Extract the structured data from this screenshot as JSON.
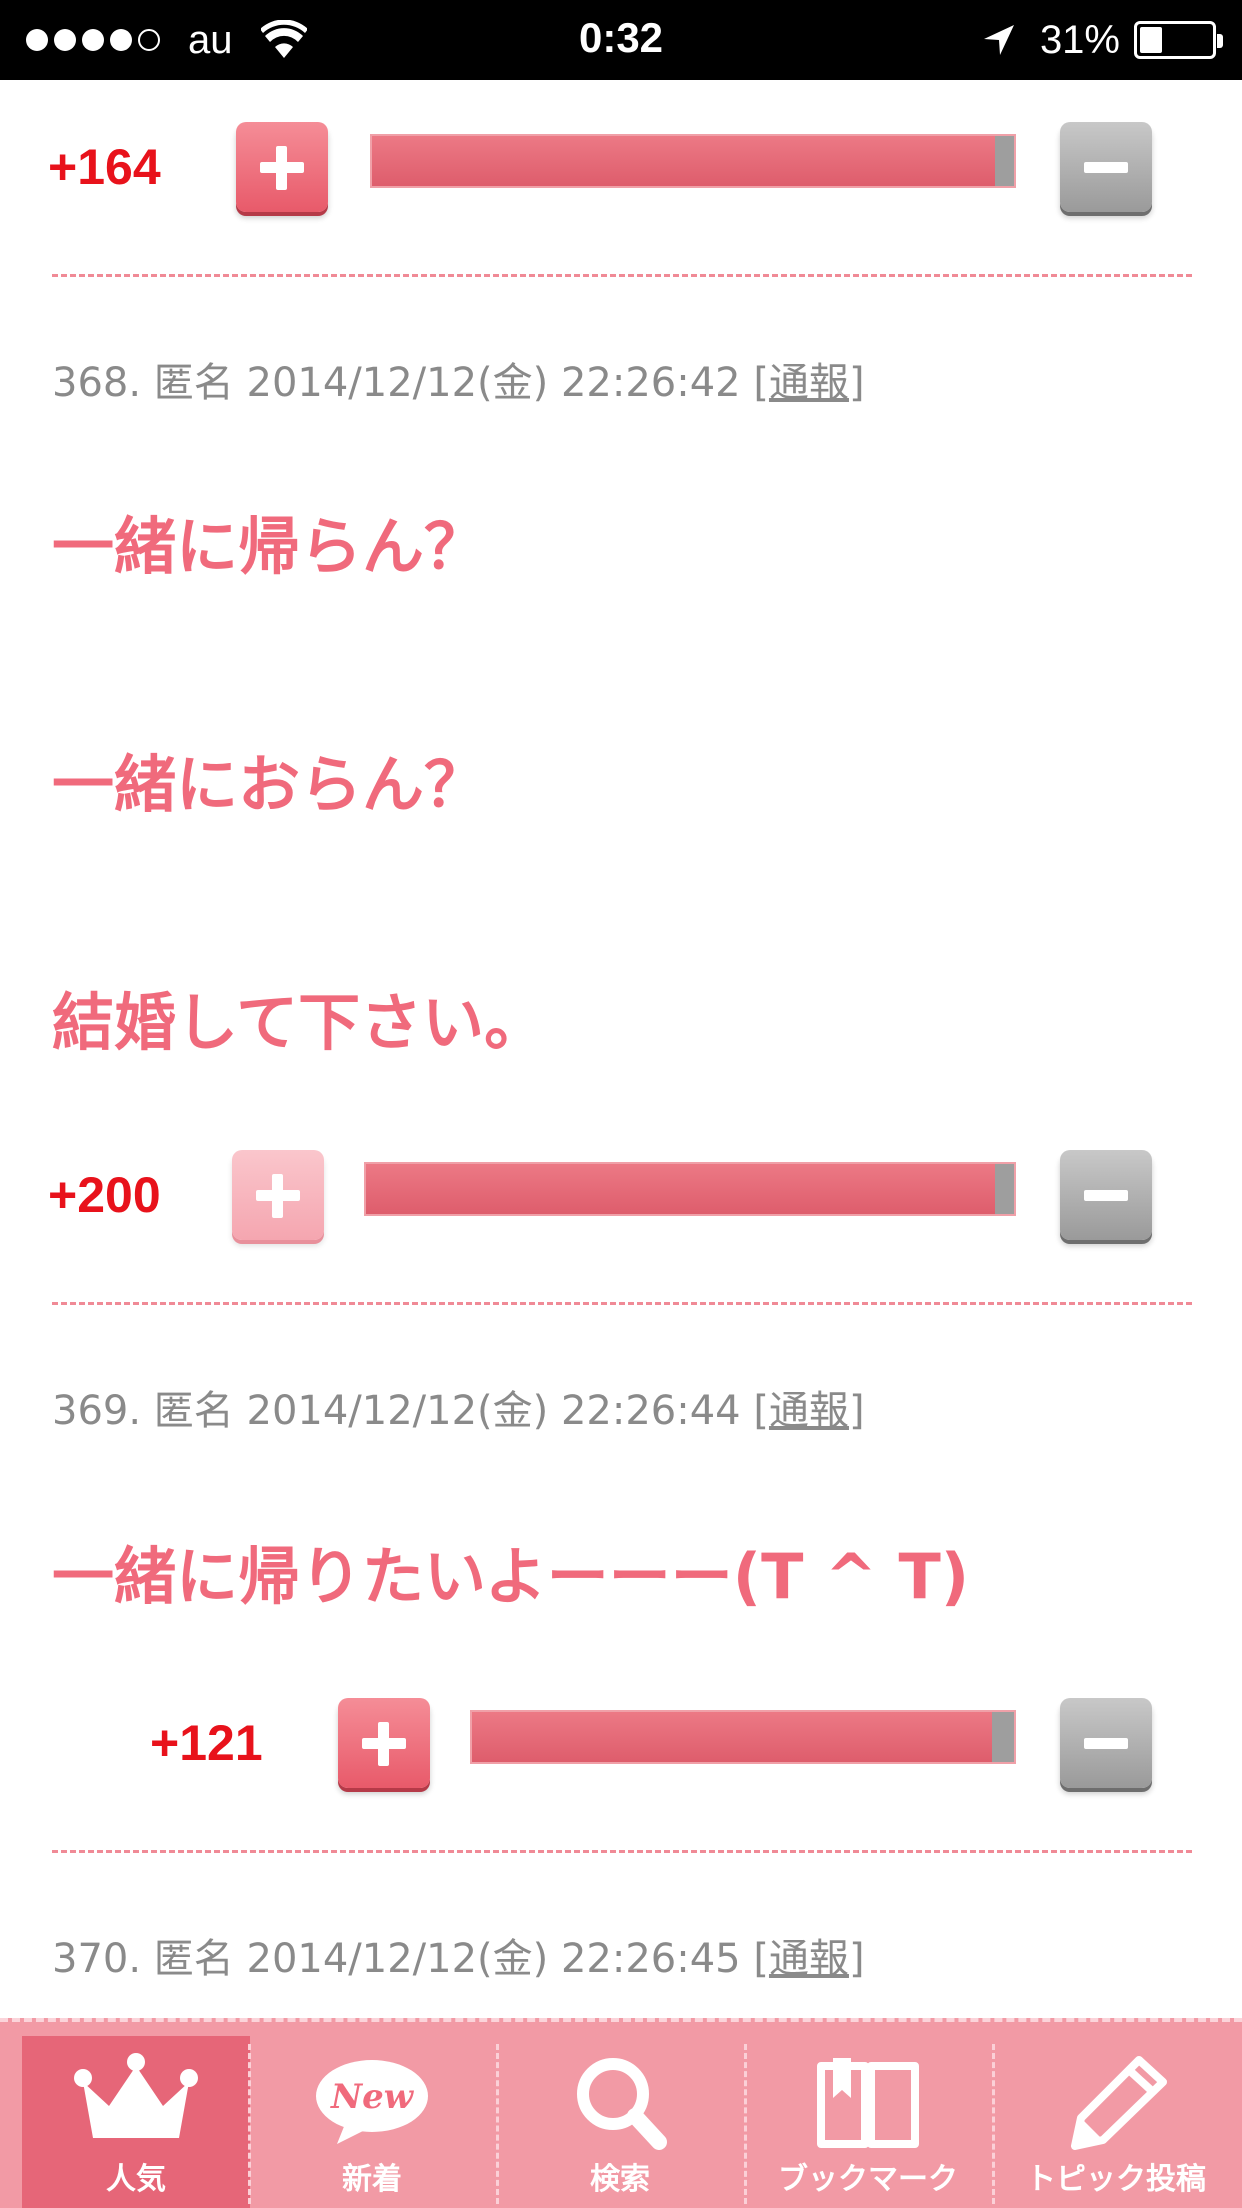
{
  "status_bar": {
    "carrier": "au",
    "time": "0:32",
    "battery_percent_text": "31%",
    "battery_level": 0.31
  },
  "votes": [
    {
      "score": "+164",
      "plus_ratio": 0.97
    },
    {
      "score": "+200",
      "plus_ratio": 0.97
    },
    {
      "score": "+121",
      "plus_ratio": 0.96
    }
  ],
  "comments": [
    {
      "number": "368.",
      "author": "匿名",
      "date": "2014/12/12(金)",
      "time": "22:26:42",
      "report_label": "通報",
      "lines": [
        "一緒に帰らん？",
        "一緒におらん？",
        "結婚して下さい。"
      ]
    },
    {
      "number": "369.",
      "author": "匿名",
      "date": "2014/12/12(金)",
      "time": "22:26:44",
      "report_label": "通報",
      "lines": [
        "一緒に帰りたいよーーー(T ^ T)"
      ]
    },
    {
      "number": "370.",
      "author": "匿名",
      "date": "2014/12/12(金)",
      "time": "22:26:45",
      "report_label": "通報",
      "lines": []
    }
  ],
  "tabs": [
    {
      "label": "人気",
      "icon": "crown-icon",
      "active": true
    },
    {
      "label": "新着",
      "icon": "new-bubble-icon",
      "badge": "New",
      "active": false
    },
    {
      "label": "検索",
      "icon": "search-icon",
      "active": false
    },
    {
      "label": "ブックマーク",
      "icon": "bookmark-book-icon",
      "active": false
    },
    {
      "label": "トピック投稿",
      "icon": "pencil-icon",
      "active": false
    }
  ],
  "colors": {
    "score": "#e8121b",
    "comment_text": "#f06a7c",
    "tab_bar": "#f29aa5",
    "tab_active": "#e66678"
  }
}
